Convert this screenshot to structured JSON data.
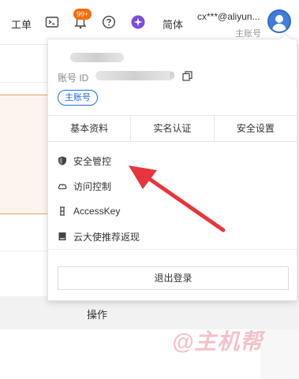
{
  "topbar": {
    "ticket_label": "工单",
    "notification_badge": "99+",
    "lang_label": "简体",
    "user_name": "cx***@aliyun...",
    "user_role": "主账号"
  },
  "background": {
    "table_header_action": "操作"
  },
  "dropdown": {
    "account_id_label": "账号 ID",
    "account_id_tail": "8",
    "account_type_badge": "主账号",
    "tabs": [
      {
        "label": "基本资料"
      },
      {
        "label": "实名认证"
      },
      {
        "label": "安全设置"
      }
    ],
    "menu": [
      {
        "label": "安全管控",
        "icon": "shield-icon"
      },
      {
        "label": "访问控制",
        "icon": "cloud-icon"
      },
      {
        "label": "AccessKey",
        "icon": "key-icon"
      },
      {
        "label": "云大使推荐返现",
        "icon": "book-icon"
      }
    ],
    "logout_label": "退出登录"
  },
  "watermark": "@主机帮",
  "colors": {
    "accent": "#1a6be6",
    "badge": "#ff6a00",
    "arrow": "#e8343b"
  }
}
